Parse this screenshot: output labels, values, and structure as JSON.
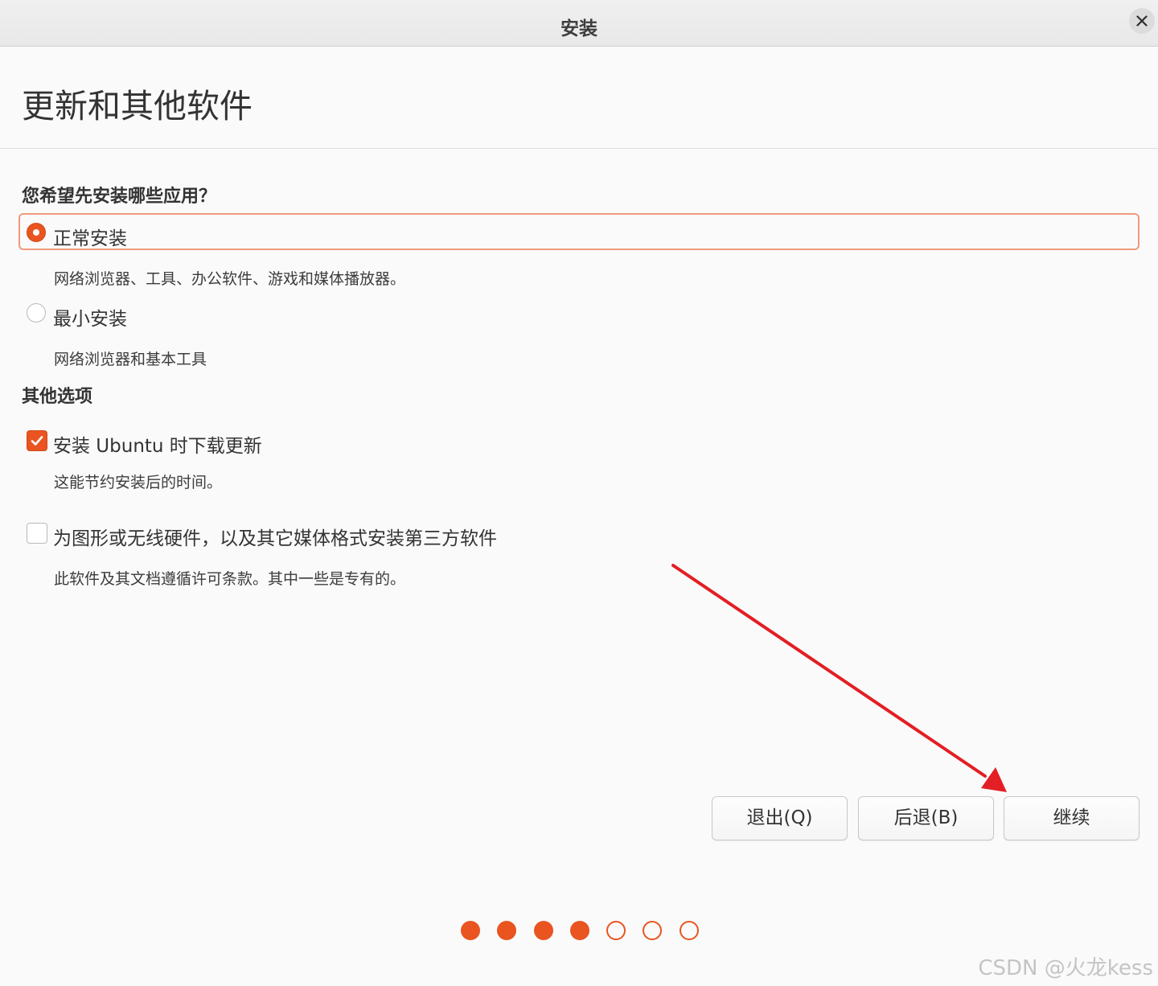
{
  "window": {
    "title": "安装",
    "close_icon": "close-icon"
  },
  "page": {
    "title": "更新和其他软件"
  },
  "install_type": {
    "heading": "您希望先安装哪些应用？",
    "options": [
      {
        "label": "正常安装",
        "description": "网络浏览器、工具、办公软件、游戏和媒体播放器。",
        "selected": true
      },
      {
        "label": "最小安装",
        "description": "网络浏览器和基本工具",
        "selected": false
      }
    ]
  },
  "other_options": {
    "heading": "其他选项",
    "items": [
      {
        "label": "安装 Ubuntu 时下载更新",
        "description": "这能节约安装后的时间。",
        "checked": true
      },
      {
        "label": "为图形或无线硬件，以及其它媒体格式安装第三方软件",
        "description": "此软件及其文档遵循许可条款。其中一些是专有的。",
        "checked": false
      }
    ]
  },
  "buttons": {
    "quit": "退出(Q)",
    "back": "后退(B)",
    "continue": "继续"
  },
  "progress": {
    "completed_steps": 4,
    "total_steps": 7
  },
  "watermark": "CSDN @火龙kess",
  "colors": {
    "accent": "#e95420",
    "highlight_border": "#ee9a7c",
    "annotation_arrow": "#e31e24"
  }
}
